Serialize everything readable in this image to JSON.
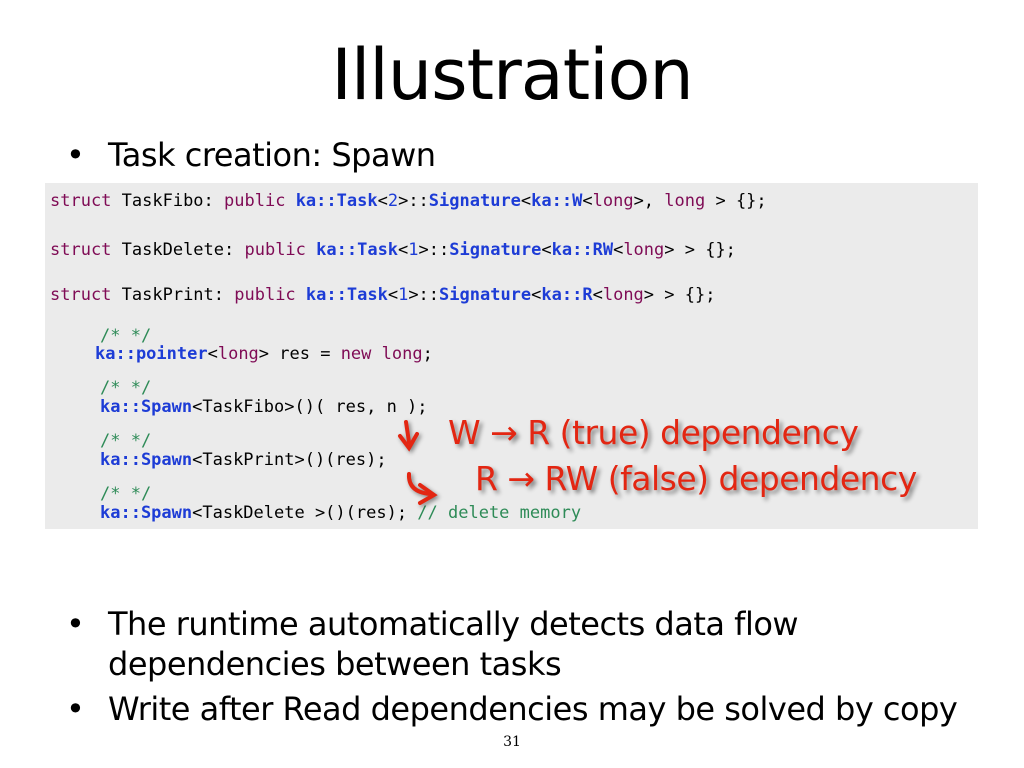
{
  "slide": {
    "title": "Illustration",
    "bullet1": "Task creation: Spawn",
    "bullet2": "The runtime automatically detects data flow dependencies between tasks",
    "bullet3": "Write after Read dependencies may be solved by copy",
    "page_number": "31"
  },
  "code": {
    "l1": {
      "a": "struct",
      "b": " TaskFibo: ",
      "c": "public",
      "d": " ",
      "e": "ka::Task",
      "f": "<",
      "g": "2",
      "h": ">::",
      "i": "Signature",
      "j": "<",
      "k": "ka::W",
      "l": "<",
      "m": "long",
      "n": ">, ",
      "o": "long",
      "p": " > {};"
    },
    "l2": {
      "a": "struct",
      "b": " TaskDelete: ",
      "c": "public",
      "d": " ",
      "e": "ka::Task",
      "f": "<",
      "g": "1",
      "h": ">::",
      "i": "Signature",
      "j": "<",
      "k": "ka::RW",
      "l": "<",
      "m": "long",
      "n": "> > {};"
    },
    "l3": {
      "a": "struct",
      "b": " TaskPrint: ",
      "c": "public",
      "d": " ",
      "e": "ka::Task",
      "f": "<",
      "g": "1",
      "h": ">::",
      "i": "Signature",
      "j": "<",
      "k": "ka::R",
      "l": "<",
      "m": "long",
      "n": "> > {};"
    },
    "c1": "/* */",
    "l4": {
      "a": "ka::pointer",
      "b": "<",
      "c": "long",
      "d": "> res = ",
      "e": "new",
      "f": " ",
      "g": "long",
      "h": ";"
    },
    "c2": "/* */",
    "l5": {
      "a": "ka::Spawn",
      "b": "<TaskFibo>()( res, n );"
    },
    "c3": "/* */",
    "l6": {
      "a": "ka::Spawn",
      "b": "<TaskPrint>()(res);"
    },
    "c4": "/* */",
    "l7": {
      "a": "ka::Spawn",
      "b": "<TaskDelete >()(res); ",
      "c": "// delete memory"
    }
  },
  "annotations": {
    "a1": "W → R (true) dependency",
    "a2": "R → RW (false) dependency"
  },
  "colors": {
    "annotation_red": "#e32612",
    "keyword_purple": "#7f0b55",
    "identifier_blue": "#1d3cd6",
    "comment_green": "#2e8b57",
    "code_background": "#ebebeb"
  }
}
